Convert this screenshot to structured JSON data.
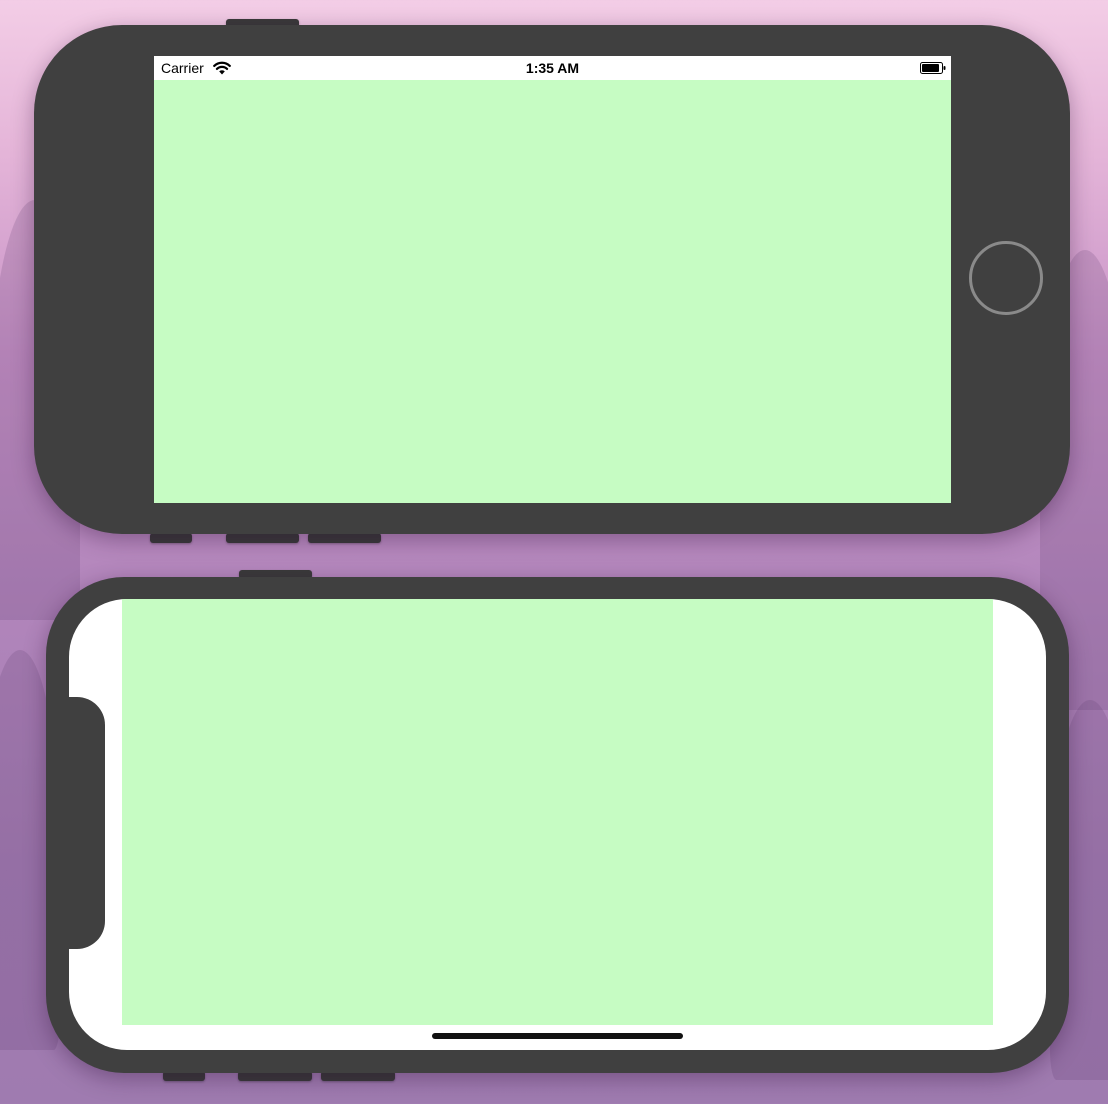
{
  "status_bar": {
    "carrier": "Carrier",
    "time": "1:35 AM",
    "wifi_icon": "wifi-icon",
    "battery_icon": "battery-icon"
  },
  "colors": {
    "app_background": "#c6fcc3",
    "device_frame": "#404040",
    "status_bar_background": "#ffffff"
  }
}
